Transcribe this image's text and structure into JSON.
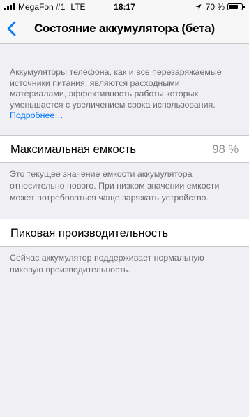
{
  "status_bar": {
    "carrier": "MegaFon #1",
    "network": "LTE",
    "time": "18:17",
    "battery_percent_text": "70 %",
    "battery_level": 0.7,
    "signal_bars": 4
  },
  "nav": {
    "back_icon": "chevron-left-icon",
    "title": "Состояние аккумулятора (бета)"
  },
  "intro": {
    "text": "Аккумуляторы телефона, как и все перезаряжаемые источники питания, являются расходными материалами, эффективность работы которых уменьшается с увеличением срока использования.",
    "link": "Подробнее…"
  },
  "max_capacity": {
    "label": "Максимальная емкость",
    "value": "98 %",
    "footer": "Это текущее значение емкости аккумулятора относительно нового. При низком значении емкости может потребоваться чаще заряжать устройство."
  },
  "peak_performance": {
    "label": "Пиковая производительность",
    "footer": "Сейчас аккумулятор поддерживает нормальную пиковую производительность."
  },
  "colors": {
    "accent": "#007aff",
    "background": "#efeff4",
    "secondary_text": "#6d6d72"
  }
}
